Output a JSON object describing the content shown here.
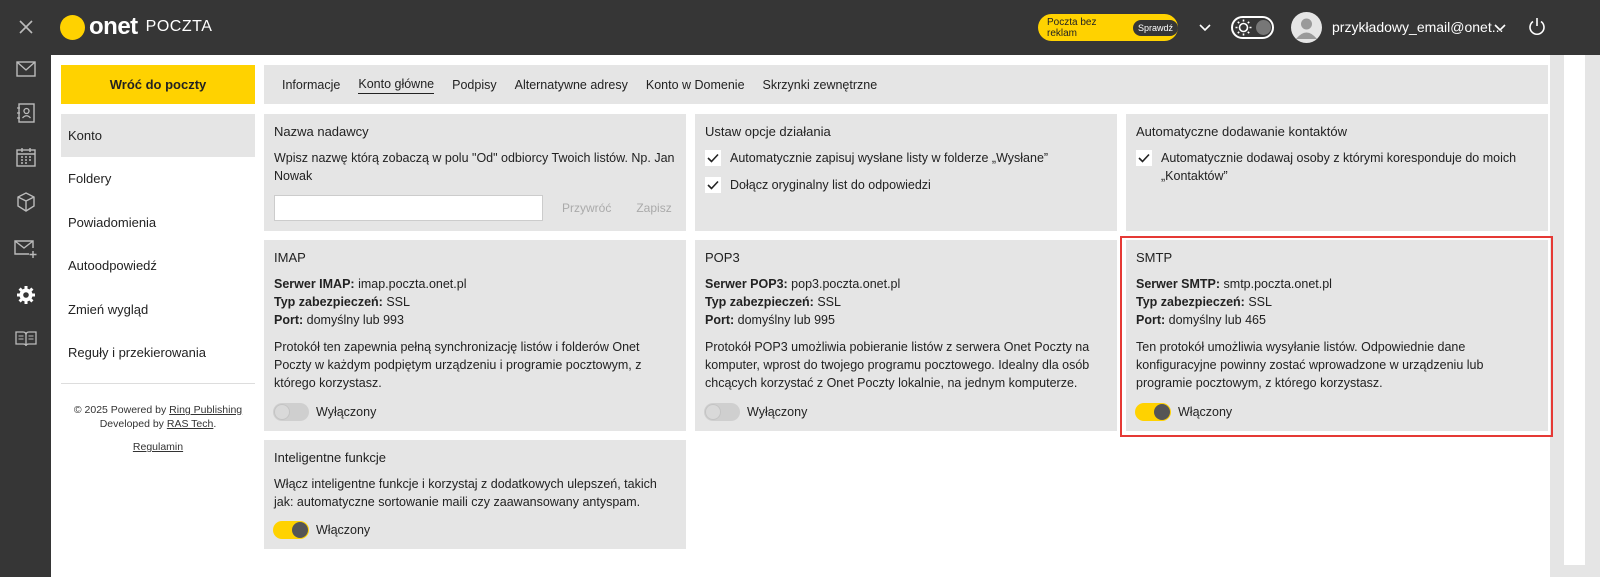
{
  "app": {
    "brand": "onet",
    "product": "POCZTA",
    "adfree_label": "Poczta bez reklam",
    "adfree_check": "Sprawdź",
    "account_email": "przykładowy_email@onet..."
  },
  "rail": {
    "items": [
      {
        "icon": "close-icon"
      },
      {
        "icon": "mail-icon"
      },
      {
        "icon": "contacts-icon"
      },
      {
        "icon": "calendar-icon"
      },
      {
        "icon": "box-icon"
      },
      {
        "icon": "mail-add-icon"
      },
      {
        "icon": "settings-icon"
      },
      {
        "icon": "book-icon"
      }
    ]
  },
  "sidebar": {
    "back_label": "Wróć do poczty",
    "items": [
      {
        "label": "Konto",
        "active": true
      },
      {
        "label": "Foldery"
      },
      {
        "label": "Powiadomienia"
      },
      {
        "label": "Autoodpowiedź"
      },
      {
        "label": "Zmień wygląd"
      },
      {
        "label": "Reguły i przekierowania"
      }
    ],
    "footer": {
      "powered": "© 2025 Powered by",
      "ring": "Ring Publishing",
      "developed": "Developed by",
      "ras": "RAS Tech",
      "terms": "Regulamin"
    }
  },
  "tabs": [
    {
      "label": "Informacje"
    },
    {
      "label": "Konto główne",
      "active": true
    },
    {
      "label": "Podpisy"
    },
    {
      "label": "Alternatywne adresy"
    },
    {
      "label": "Konto w Domenie"
    },
    {
      "label": "Skrzynki zewnętrzne"
    }
  ],
  "sender": {
    "title": "Nazwa nadawcy",
    "desc": "Wpisz nazwę którą zobaczą w polu \"Od\" odbiorcy Twoich listów. Np. Jan Nowak",
    "value": "",
    "restore": "Przywróć",
    "save": "Zapisz"
  },
  "actions": {
    "title": "Ustaw opcje działania",
    "opt1": "Automatycznie zapisuj wysłane listy w folderze „Wysłane”",
    "opt2": "Dołącz oryginalny list do odpowiedzi"
  },
  "contacts": {
    "title": "Automatyczne dodawanie kontaktów",
    "opt1": "Automatycznie dodawaj osoby z którymi koresponduje do moich „Kontaktów”"
  },
  "imap": {
    "title": "IMAP",
    "server_label": "Serwer IMAP:",
    "server": "imap.poczta.onet.pl",
    "sec_label": "Typ zabezpieczeń:",
    "sec": "SSL",
    "port_label": "Port:",
    "port": "domyślny lub 993",
    "desc": "Protokół ten zapewnia pełną synchronizację listów i folderów Onet Poczty w każdym podpiętym urządzeniu i programie pocztowym, z którego korzystasz.",
    "status": "Wyłączony"
  },
  "pop3": {
    "title": "POP3",
    "server_label": "Serwer POP3:",
    "server": "pop3.poczta.onet.pl",
    "sec_label": "Typ zabezpieczeń:",
    "sec": "SSL",
    "port_label": "Port:",
    "port": "domyślny lub 995",
    "desc": "Protokół POP3 umożliwia pobieranie listów z serwera Onet Poczty na komputer, wprost do twojego programu pocztowego. Idealny dla osób chcących korzystać z Onet Poczty lokalnie, na jednym komputerze.",
    "status": "Wyłączony"
  },
  "smtp": {
    "title": "SMTP",
    "server_label": "Serwer SMTP:",
    "server": "smtp.poczta.onet.pl",
    "sec_label": "Typ zabezpieczeń:",
    "sec": "SSL",
    "port_label": "Port:",
    "port": "domyślny lub 465",
    "desc": "Ten protokół umożliwia wysyłanie listów. Odpowiednie dane konfiguracyjne powinny zostać wprowadzone w urządzeniu lub programie pocztowym, z którego korzystasz.",
    "status": "Włączony"
  },
  "smart": {
    "title": "Inteligentne funkcje",
    "desc": "Włącz inteligentne funkcje i korzystaj z dodatkowych ulepszeń, takich jak: automatyczne sortowanie maili czy zaawansowany antyspam.",
    "status": "Włączony"
  },
  "colors": {
    "accent": "#ffd200",
    "dark": "#363636",
    "panel": "#e5e5e5",
    "highlight": "#e53935"
  }
}
